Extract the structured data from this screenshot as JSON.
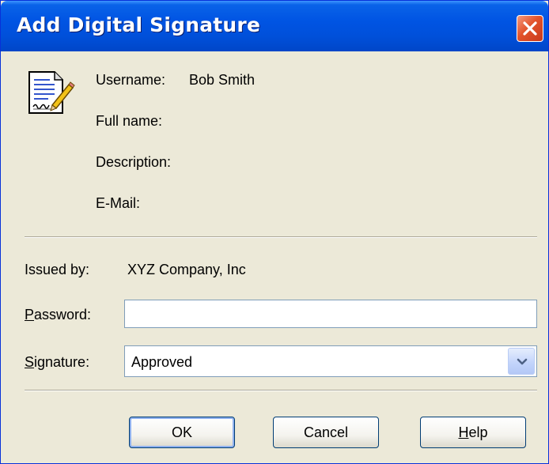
{
  "window": {
    "title": "Add Digital Signature"
  },
  "user_info": {
    "username_label": "Username:",
    "username_value": "Bob Smith",
    "fullname_label": "Full name:",
    "description_label": "Description:",
    "email_label": "E-Mail:"
  },
  "issued": {
    "label": "Issued by:",
    "value": "XYZ Company, Inc"
  },
  "password": {
    "label_mnemonic": "P",
    "label_rest": "assword:",
    "value": ""
  },
  "signature": {
    "label_mnemonic": "S",
    "label_rest": "ignature:",
    "selected": "Approved"
  },
  "buttons": {
    "ok": "OK",
    "cancel": "Cancel",
    "help_mnemonic": "H",
    "help_rest": "elp"
  },
  "icons": {
    "close": "close-icon",
    "document": "signature-document-icon",
    "dropdown": "chevron-down-icon"
  },
  "colors": {
    "titlebar": "#0054E3",
    "close_button": "#E2532B",
    "dialog_background": "#ECE9D8",
    "input_border": "#7F9DB9"
  }
}
